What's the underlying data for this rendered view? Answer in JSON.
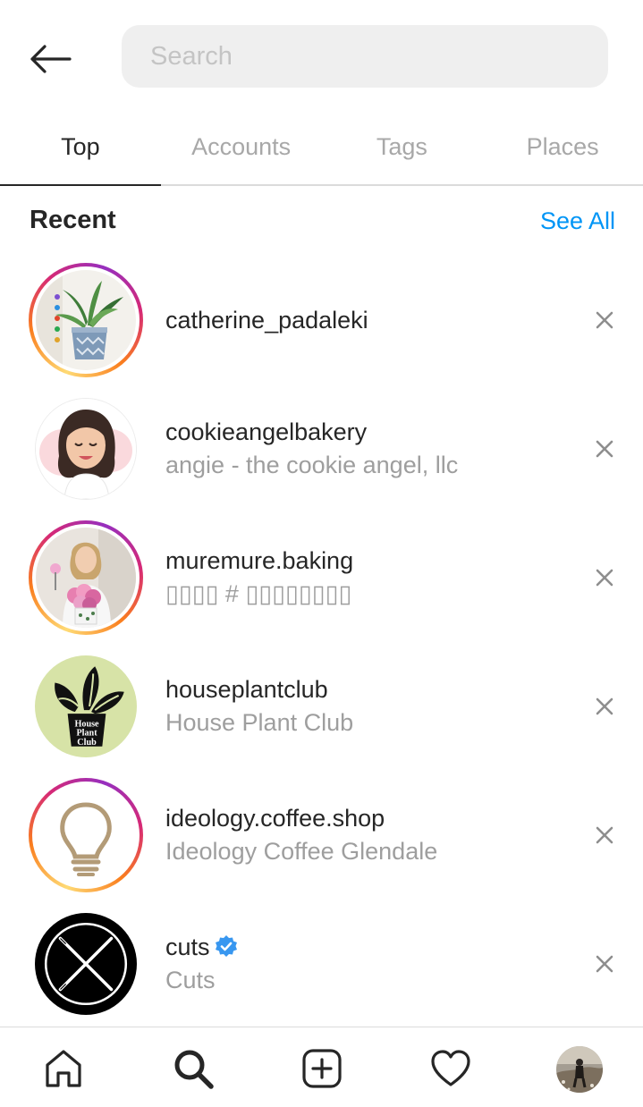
{
  "search": {
    "placeholder": "Search",
    "value": ""
  },
  "tabs": [
    {
      "label": "Top",
      "active": true
    },
    {
      "label": "Accounts",
      "active": false
    },
    {
      "label": "Tags",
      "active": false
    },
    {
      "label": "Places",
      "active": false
    }
  ],
  "recent": {
    "title": "Recent",
    "see_all": "See All",
    "items": [
      {
        "username": "catherine_padaleki",
        "subtitle": "",
        "story_ring": true,
        "verified": false,
        "avatar_icon": "potted-plant-photo"
      },
      {
        "username": "cookieangelbakery",
        "subtitle": "angie - the cookie angel, llc",
        "story_ring": false,
        "verified": false,
        "avatar_icon": "cartoon-woman-avatar"
      },
      {
        "username": "muremure.baking",
        "subtitle": "▯▯▯▯ # ▯▯▯▯▯▯▯▯",
        "story_ring": true,
        "verified": false,
        "avatar_icon": "woman-with-flowers-photo"
      },
      {
        "username": "houseplantclub",
        "subtitle": "House Plant Club",
        "story_ring": false,
        "verified": false,
        "avatar_icon": "house-plant-club-logo"
      },
      {
        "username": "ideology.coffee.shop",
        "subtitle": "Ideology Coffee Glendale",
        "story_ring": true,
        "verified": false,
        "avatar_icon": "lightbulb-logo"
      },
      {
        "username": "cuts",
        "subtitle": "Cuts",
        "story_ring": false,
        "verified": true,
        "avatar_icon": "crossed-needles-logo"
      }
    ]
  },
  "logo_text": {
    "house_plant_club": "House Plant Club"
  },
  "colors": {
    "accent": "#0095f6",
    "text": "#262626",
    "muted": "#9e9e9e",
    "search_bg": "#efefef"
  },
  "bottom_nav": [
    "home-icon",
    "search-icon",
    "new-post-icon",
    "heart-icon",
    "profile-avatar"
  ]
}
